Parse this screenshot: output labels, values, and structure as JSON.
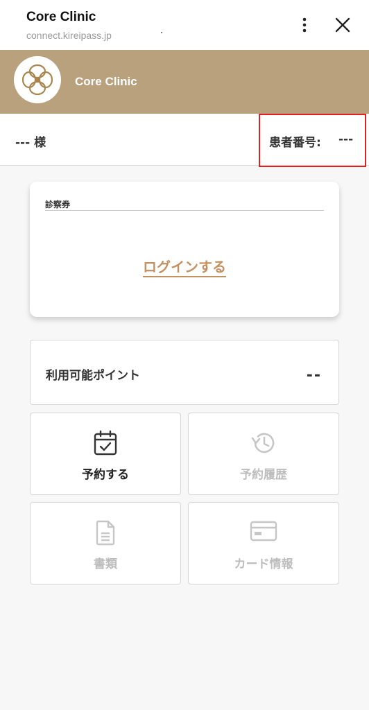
{
  "browser": {
    "title": "Core Clinic",
    "url": "connect.kireipass.jp",
    "menu_icon": "more-vertical-icon",
    "close_icon": "close-icon"
  },
  "banner": {
    "clinic_name": "Core Clinic",
    "logo_icon": "clinic-logo",
    "color": "#b9a17e"
  },
  "patient": {
    "name": "--- 様",
    "id_label": "患者番号:",
    "id_value": "---",
    "highlight_color": "#e02020"
  },
  "ticket": {
    "label": "診察券",
    "login_link": "ログインする",
    "link_color": "#c49060"
  },
  "points": {
    "label": "利用可能ポイント",
    "value": "--"
  },
  "tiles": [
    {
      "label": "予約する",
      "icon": "calendar-check-icon",
      "enabled": true
    },
    {
      "label": "予約履歴",
      "icon": "history-icon",
      "enabled": false
    },
    {
      "label": "書類",
      "icon": "document-icon",
      "enabled": false
    },
    {
      "label": "カード情報",
      "icon": "credit-card-icon",
      "enabled": false
    }
  ]
}
